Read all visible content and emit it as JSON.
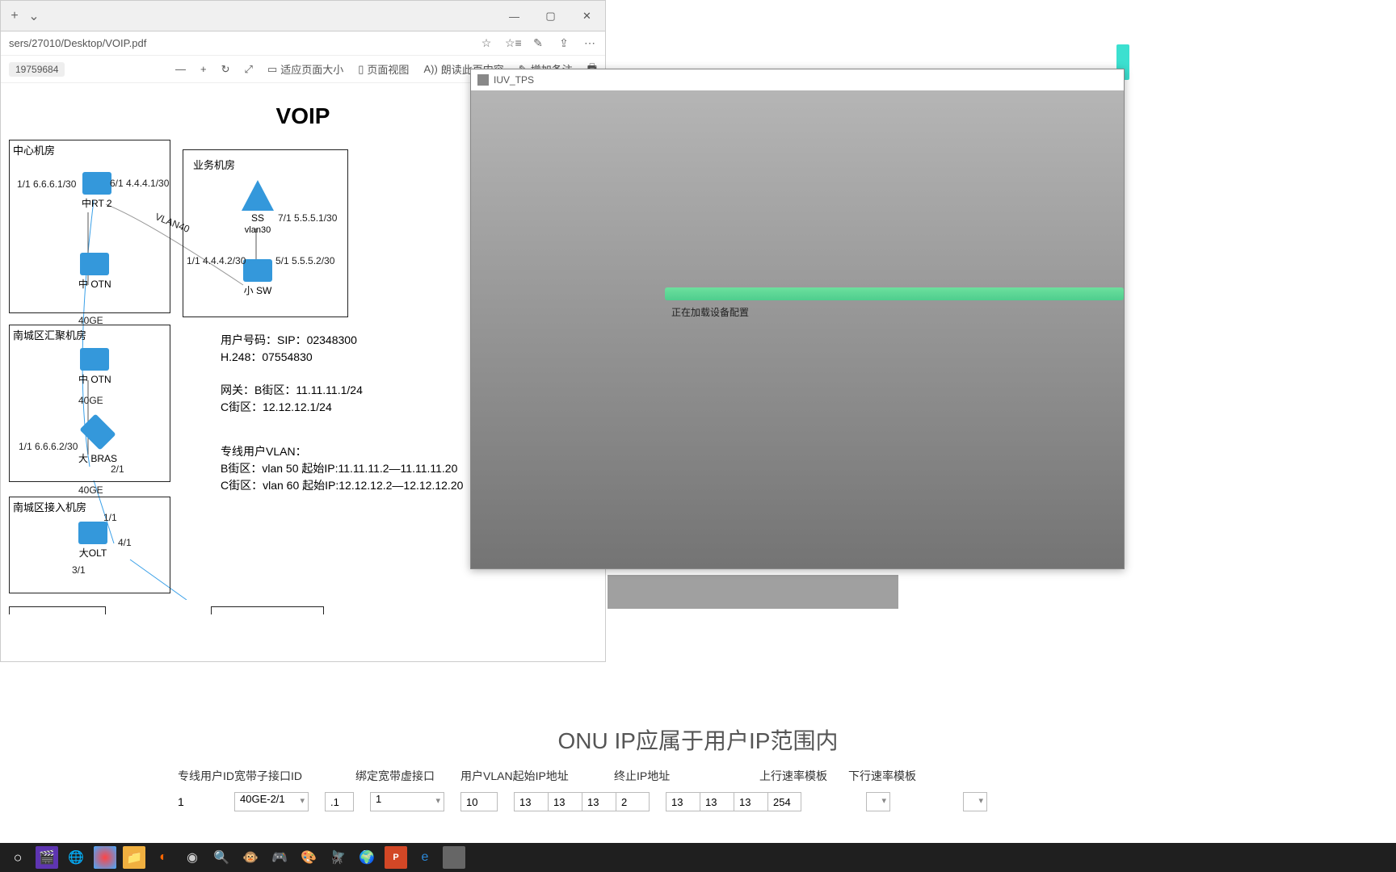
{
  "browser": {
    "url": "sers/27010/Desktop/VOIP.pdf",
    "pdf": {
      "page_badge": "19759684",
      "fit": "适应页面大小",
      "pageview": "页面视图",
      "read": "朗读此页内容",
      "note": "增加备注"
    }
  },
  "dialog": {
    "title": "IUV_TPS",
    "status": "正在加载设备配置"
  },
  "diagram": {
    "title": "VOIP",
    "rooms": {
      "center": "中心机房",
      "biz": "业务机房",
      "agg": "南城区汇聚机房",
      "access": "南城区接入机房"
    },
    "labels": {
      "rt2": "中RT 2",
      "otn1": "中 OTN",
      "otn2": "中 OTN",
      "bras": "大 BRAS",
      "olt": "大OLT",
      "ss": "SS",
      "sw": "小 SW",
      "vlan30": "vlan30",
      "vlan40": "VLAN40",
      "ge40": "40GE"
    },
    "ips": {
      "rt_l": "1/1  6.6.6.1/30",
      "rt_r": "6/1  4.4.4.1/30",
      "ss_r": "7/1  5.5.5.1/30",
      "sw_l": "1/1  4.4.4.2/30",
      "sw_r": "5/1  5.5.5.2/30",
      "bras_l": "1/1  6.6.6.2/30",
      "bras_r": "2/1",
      "olt_1": "1/1",
      "olt_4": "4/1",
      "olt_3": "3/1"
    },
    "text": {
      "t1a": "用户号码：SIP：02348300",
      "t1b": "H.248：07554830",
      "t2a": "网关：B街区：11.11.11.1/24",
      "t2b": "C街区：12.12.12.1/24",
      "t3a": "专线用户VLAN：",
      "t3b": "B街区：vlan 50 起始IP:11.11.11.2—11.11.11.20",
      "t3c": "C街区：vlan 60 起始IP:12.12.12.2—12.12.12.20"
    }
  },
  "footer": {
    "note": "ONU IP应属于用户IP范围内",
    "headers": {
      "h1": "专线用户ID宽带子接口ID",
      "h2": "绑定宽带虚接口",
      "h3": "用户VLAN起始IP地址",
      "h4": "终止IP地址",
      "h5": "上行速率模板",
      "h6": "下行速率模板"
    },
    "row": {
      "id": "1",
      "sub": "40GE-2/1",
      "dot": ".1",
      "bind": "1",
      "vlan": "10",
      "ip_start": [
        "13",
        "13",
        "13",
        "2"
      ],
      "ip_end": [
        "13",
        "13",
        "13",
        "254"
      ]
    }
  },
  "taskbar_icons": [
    "start",
    "clap",
    "chrome",
    "paint",
    "files",
    "blender",
    "steam",
    "search",
    "monkey",
    "gamepad",
    "brush",
    "fly",
    "globe",
    "ppt",
    "edge",
    "app"
  ]
}
